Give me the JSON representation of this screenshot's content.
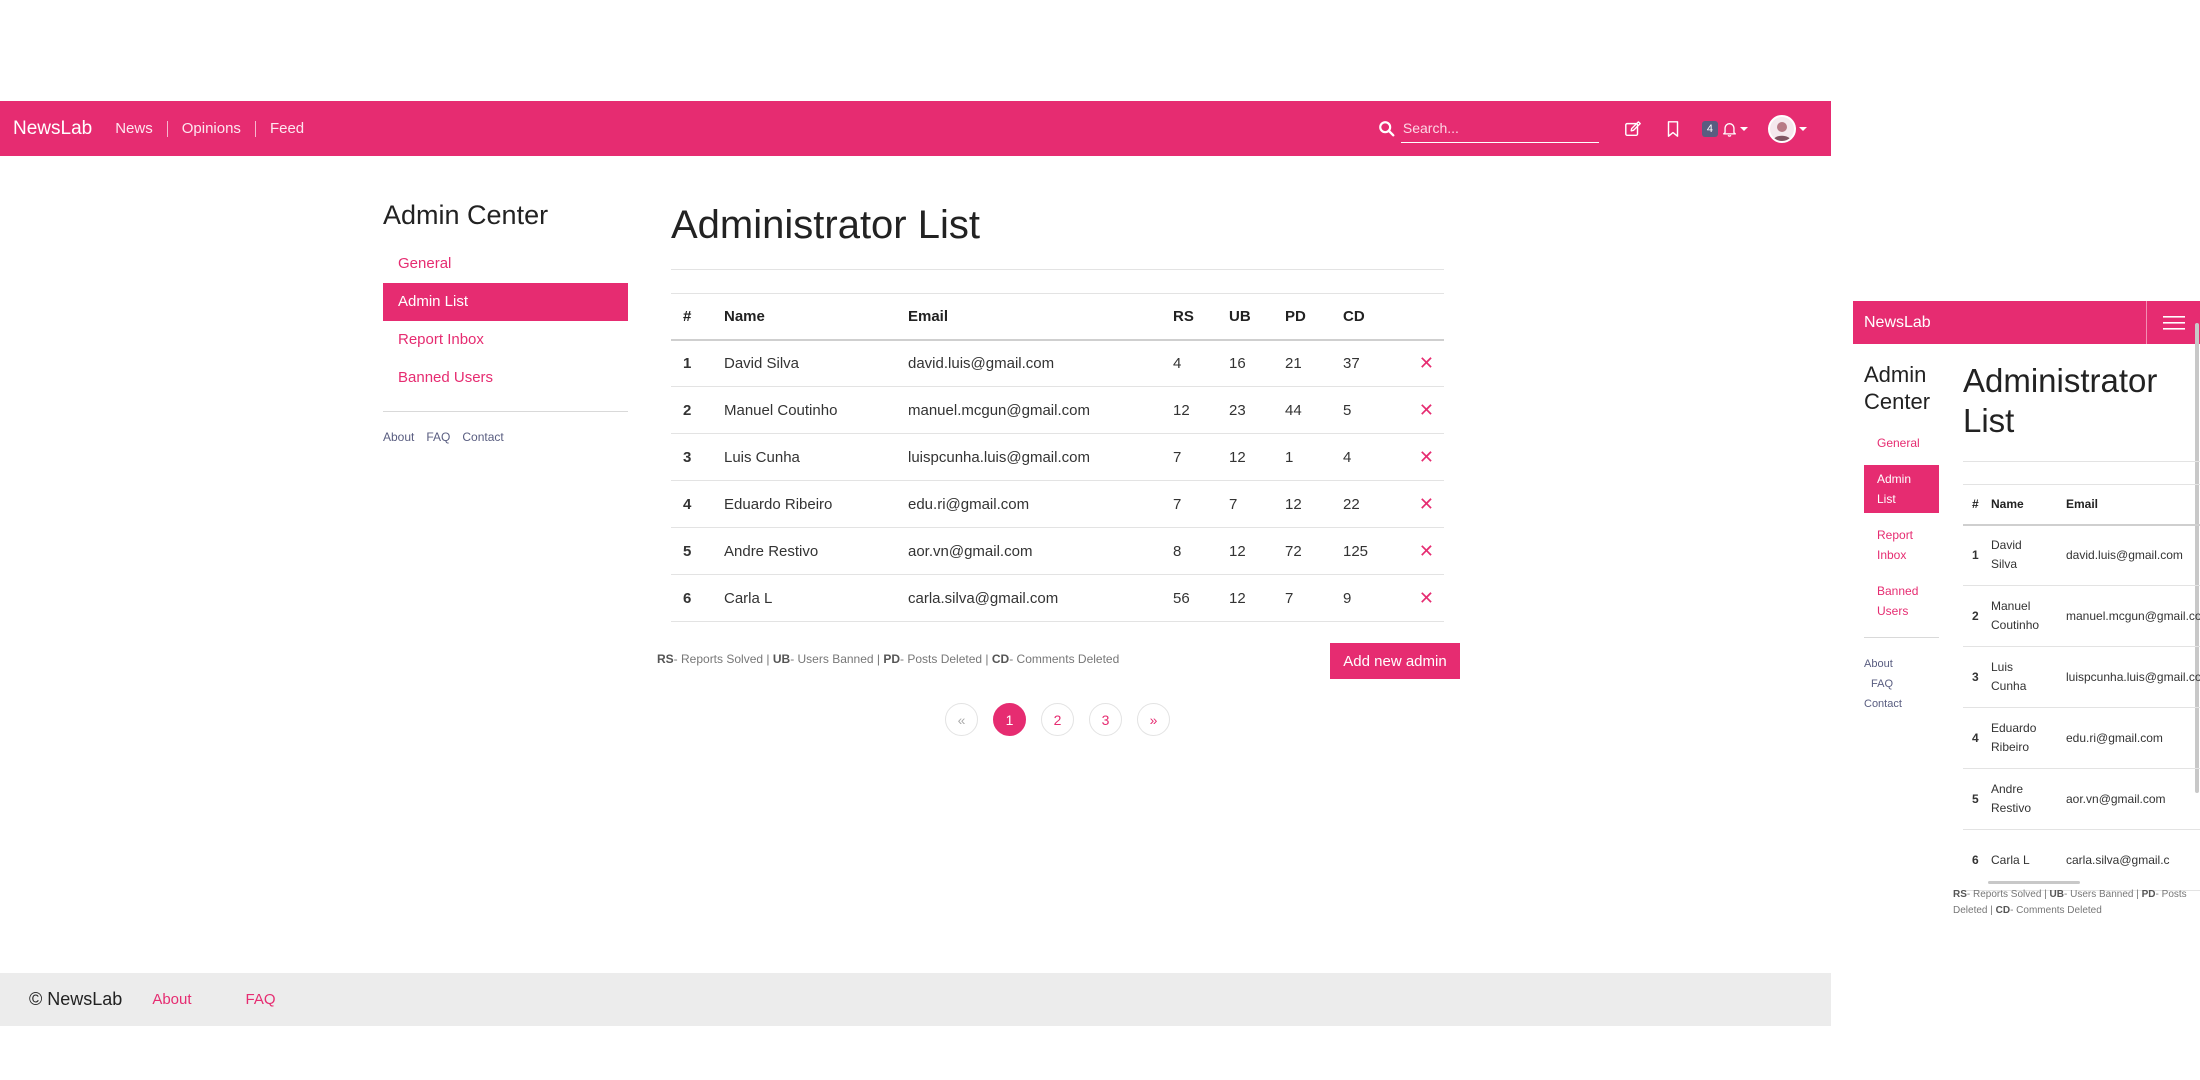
{
  "brand": "NewsLab",
  "nav": {
    "links": [
      "News",
      "Opinions",
      "Feed"
    ]
  },
  "search": {
    "placeholder": "Search..."
  },
  "icons": {
    "search": "search-icon",
    "compose": "pencil-square-icon",
    "bookmark": "bookmark-icon",
    "bell": "bell-icon",
    "avatar": "user-avatar-icon",
    "delete": "close-x-icon",
    "menu": "hamburger-menu-icon"
  },
  "notifications": {
    "count": "4"
  },
  "sidebar": {
    "title": "Admin Center",
    "items": [
      "General",
      "Admin List",
      "Report Inbox",
      "Banned Users"
    ],
    "active_index": 1,
    "footer_links": [
      "About",
      "FAQ",
      "Contact"
    ]
  },
  "main": {
    "title": "Administrator List",
    "columns": [
      "#",
      "Name",
      "Email",
      "RS",
      "UB",
      "PD",
      "CD"
    ],
    "rows": [
      {
        "id": "1",
        "name": "David Silva",
        "email": "david.luis@gmail.com",
        "rs": "4",
        "ub": "16",
        "pd": "21",
        "cd": "37"
      },
      {
        "id": "2",
        "name": "Manuel Coutinho",
        "email": "manuel.mcgun@gmail.com",
        "rs": "12",
        "ub": "23",
        "pd": "44",
        "cd": "5"
      },
      {
        "id": "3",
        "name": "Luis Cunha",
        "email": "luispcunha.luis@gmail.com",
        "rs": "7",
        "ub": "12",
        "pd": "1",
        "cd": "4"
      },
      {
        "id": "4",
        "name": "Eduardo Ribeiro",
        "email": "edu.ri@gmail.com",
        "rs": "7",
        "ub": "7",
        "pd": "12",
        "cd": "22"
      },
      {
        "id": "5",
        "name": "Andre Restivo",
        "email": "aor.vn@gmail.com",
        "rs": "8",
        "ub": "12",
        "pd": "72",
        "cd": "125"
      },
      {
        "id": "6",
        "name": "Carla L",
        "email": "carla.silva@gmail.com",
        "rs": "56",
        "ub": "12",
        "pd": "7",
        "cd": "9"
      }
    ],
    "delete_symbol": "✕",
    "legend": [
      {
        "abbr": "RS",
        "text": "- Reports Solved"
      },
      {
        "abbr": "UB",
        "text": "- Users Banned"
      },
      {
        "abbr": "PD",
        "text": "- Posts Deleted"
      },
      {
        "abbr": "CD",
        "text": "- Comments Deleted"
      }
    ],
    "legend_sep": " | ",
    "add_button": "Add new admin",
    "pagination": {
      "prev": "«",
      "pages": [
        "1",
        "2",
        "3"
      ],
      "next": "»",
      "current": "1"
    }
  },
  "footer": {
    "copyright": "© NewsLab",
    "links": [
      "About",
      "FAQ"
    ]
  },
  "mobile": {
    "sidebar_title_lines": [
      "Admin",
      "Center"
    ],
    "sidebar_item_lines": [
      [
        "General"
      ],
      [
        "Admin",
        "List"
      ],
      [
        "Report",
        "Inbox"
      ],
      [
        "Banned",
        "Users"
      ]
    ],
    "title_lines": [
      "Administrator",
      "List"
    ],
    "columns": [
      "#",
      "Name",
      "Email"
    ],
    "rows": [
      {
        "id": "1",
        "name_lines": [
          "David",
          "Silva"
        ],
        "email": "david.luis@gmail.com"
      },
      {
        "id": "2",
        "name_lines": [
          "Manuel",
          "Coutinho"
        ],
        "email": "manuel.mcgun@gmail.com"
      },
      {
        "id": "3",
        "name_lines": [
          "Luis",
          "Cunha"
        ],
        "email": "luispcunha.luis@gmail.com"
      },
      {
        "id": "4",
        "name_lines": [
          "Eduardo",
          "Ribeiro"
        ],
        "email": "edu.ri@gmail.com"
      },
      {
        "id": "5",
        "name_lines": [
          "Andre",
          "Restivo"
        ],
        "email": "aor.vn@gmail.com"
      },
      {
        "id": "6",
        "name_lines": [
          "Carla L"
        ],
        "email": "carla.silva@gmail.c"
      }
    ]
  },
  "colors": {
    "brand": "#e62c71",
    "badge": "#595d80",
    "footer_bg": "#ececec"
  }
}
